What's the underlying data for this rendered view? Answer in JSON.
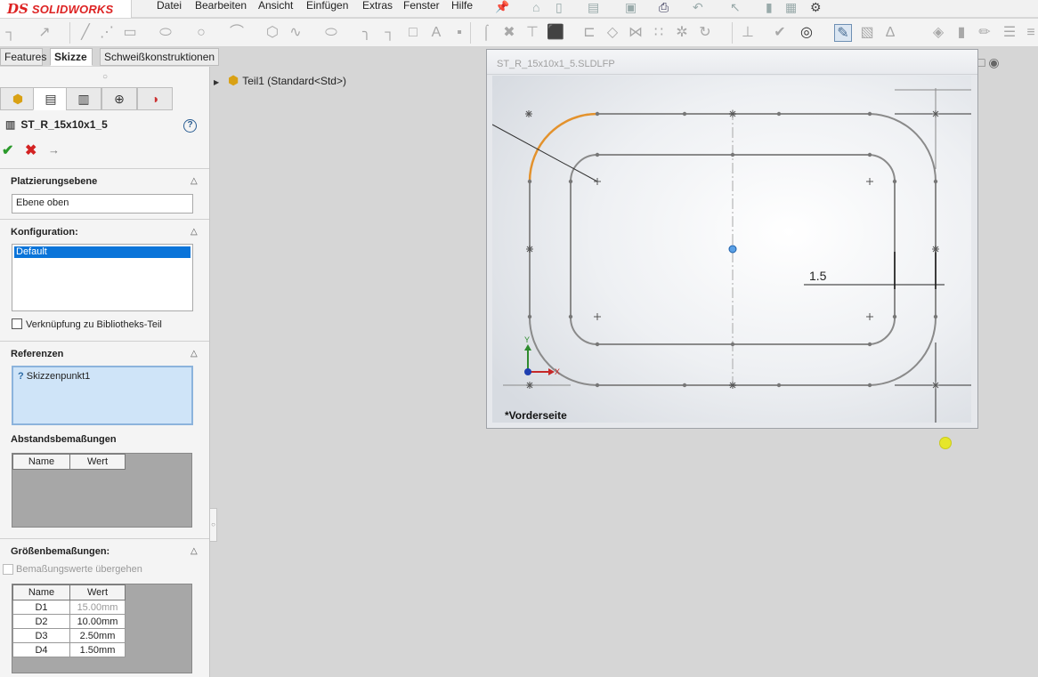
{
  "app": {
    "logo_ds": "DS",
    "logo_text": "SOLIDWORKS"
  },
  "menu": {
    "items": [
      "Datei",
      "Bearbeiten",
      "Ansicht",
      "Einfügen",
      "Extras",
      "Fenster",
      "Hilfe"
    ]
  },
  "command_tabs": {
    "items": [
      "Features",
      "Skizze",
      "Schweißkonstruktionen"
    ],
    "active": "Skizze"
  },
  "property_manager": {
    "title": "ST_R_15x10x1_5",
    "placement": {
      "heading": "Platzierungsebene",
      "value": "Ebene oben"
    },
    "configuration": {
      "heading": "Konfiguration:",
      "selected": "Default",
      "link_label": "Verknüpfung zu Bibliotheks-Teil"
    },
    "references": {
      "heading": "Referenzen",
      "item": "Skizzenpunkt1"
    },
    "distance_dims": {
      "heading": "Abstandsbemaßungen",
      "columns": [
        "Name",
        "Wert"
      ]
    },
    "size_dims": {
      "heading": "Größenbemaßungen:",
      "override_label": "Bemaßungswerte übergehen",
      "columns": [
        "Name",
        "Wert"
      ],
      "rows": [
        {
          "name": "D1",
          "value": "15.00mm"
        },
        {
          "name": "D2",
          "value": "10.00mm"
        },
        {
          "name": "D3",
          "value": "2.50mm"
        },
        {
          "name": "D4",
          "value": "1.50mm"
        }
      ]
    }
  },
  "feature_tree": {
    "item": "Teil1  (Standard<Std>)"
  },
  "graphics_window": {
    "title": "ST_R_15x10x1_5.SLDLFP",
    "view_label": "*Vorderseite",
    "dimension_text": "1.5",
    "axis_x": "X",
    "axis_y": "Y"
  }
}
